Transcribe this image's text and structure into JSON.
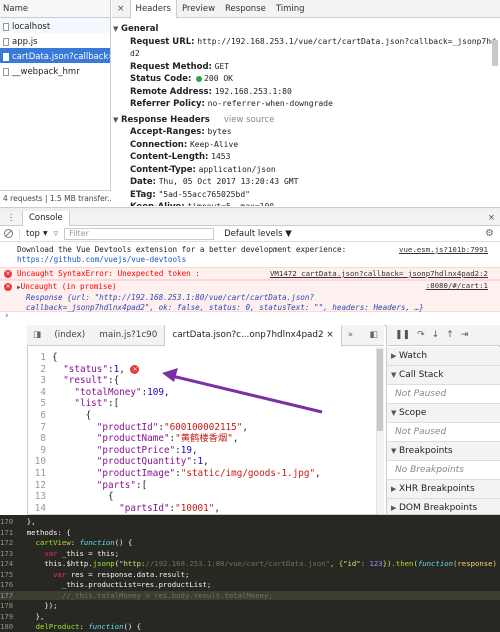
{
  "network": {
    "list_header": "Name",
    "requests": [
      "localhost",
      "app.js",
      "cartData.json?callback=_jsonp7hdlnx4pad2",
      "__webpack_hmr"
    ],
    "selected_index": 2,
    "status_bar": "4 requests | 1.5 MB transfer..."
  },
  "detail_tabs": {
    "close": "×",
    "tabs": [
      "Headers",
      "Preview",
      "Response",
      "Timing"
    ],
    "active": "Headers"
  },
  "general": {
    "title": "General",
    "request_url_key": "Request URL:",
    "request_url_val": "http://192.168.253.1/vue/cart/cartData.json?callback=_jsonp7hdlnx4pa",
    "request_url_val2": "d2",
    "method_key": "Request Method:",
    "method_val": "GET",
    "status_key": "Status Code:",
    "status_val": "200 OK",
    "remote_key": "Remote Address:",
    "remote_val": "192.168.253.1:80",
    "referrer_key": "Referrer Policy:",
    "referrer_val": "no-referrer-when-downgrade"
  },
  "response_headers": {
    "title": "Response Headers",
    "view_source": "view source",
    "items": [
      {
        "k": "Accept-Ranges:",
        "v": "bytes"
      },
      {
        "k": "Connection:",
        "v": "Keep-Alive"
      },
      {
        "k": "Content-Length:",
        "v": "1453"
      },
      {
        "k": "Content-Type:",
        "v": "application/json"
      },
      {
        "k": "Date:",
        "v": "Thu, 05 Oct 2017 13:20:43 GMT"
      },
      {
        "k": "ETag:",
        "v": "\"5ad-55acc765025bd\""
      },
      {
        "k": "Keep-Alive:",
        "v": "timeout=5, max=100"
      }
    ]
  },
  "console": {
    "menu": "⋮",
    "tab": "Console",
    "close": "×",
    "context": "top",
    "filter_placeholder": "Filter",
    "levels": "Default levels ▼",
    "lines": {
      "devtools_msg1": "Download the Vue Devtools extension for a better development experience:",
      "devtools_msg2": "https://github.com/vuejs/vue-devtools",
      "devtools_src": "vue.esm.js?101b:7991",
      "syntax_err": "Uncaught SyntaxError: Unexpected token :",
      "syntax_src": "VM1472 cartData.json?callback=_jsonp7hdlnx4pad2:2",
      "promise_err": "Uncaught (in promise)",
      "promise_src": ":8080/#/cart:1",
      "response_1": "Response {url: \"http://192.168.253.1:80/vue/cart/cartData.json?",
      "response_2": "callback=_jsonp7hdlnx4pad2\", ok: false, status: 0, statusText: \"\", headers: Headers, …}"
    },
    "prompt": "›"
  },
  "sources": {
    "tabs": [
      "(index)",
      "main.js?1c90",
      "cartData.json?c...onp7hdlnx4pad2"
    ],
    "active_tab": 2,
    "tab_close": "×",
    "nav_more": "»",
    "code": [
      {
        "n": "1",
        "t": "{"
      },
      {
        "n": "2",
        "t": "  \"status\":1,"
      },
      {
        "n": "3",
        "t": "  \"result\":{"
      },
      {
        "n": "4",
        "t": "    \"totalMoney\":109,"
      },
      {
        "n": "5",
        "t": "    \"list\":["
      },
      {
        "n": "6",
        "t": "      {"
      },
      {
        "n": "7",
        "t": "        \"productId\":\"600100002115\","
      },
      {
        "n": "8",
        "t": "        \"productName\":\"黄鹤楼香烟\","
      },
      {
        "n": "9",
        "t": "        \"productPrice\":19,"
      },
      {
        "n": "10",
        "t": "        \"productQuantity\":1,"
      },
      {
        "n": "11",
        "t": "        \"productImage\":\"static/img/goods-1.jpg\","
      },
      {
        "n": "12",
        "t": "        \"parts\":["
      },
      {
        "n": "13",
        "t": "          {"
      },
      {
        "n": "14",
        "t": "            \"partsId\":\"10001\","
      }
    ],
    "error_badge": "×"
  },
  "debugger": {
    "toolbar": [
      "❚❚",
      "↷",
      "↓",
      "↑",
      "⇥"
    ],
    "panes": [
      {
        "title": "Watch"
      },
      {
        "title": "Call Stack",
        "body": "Not Paused"
      },
      {
        "title": "Scope",
        "body": "Not Paused"
      },
      {
        "title": "Breakpoints",
        "body": "No Breakpoints"
      },
      {
        "title": "XHR Breakpoints"
      },
      {
        "title": "DOM Breakpoints"
      }
    ]
  },
  "editor": {
    "lines": [
      {
        "n": "170",
        "t": "  },"
      },
      {
        "n": "171",
        "t": "  methods: {"
      },
      {
        "n": "172",
        "t": "    cartView: function() {"
      },
      {
        "n": "173",
        "t": "      var _this = this;"
      },
      {
        "n": "174",
        "t": "      this.$http.jsonp(\"http://192.168.253.1:80/vue/cart/cartData.json\", {\"id\": 123}).then(function(response) {"
      },
      {
        "n": "175",
        "t": "        var res = response.data.result;"
      },
      {
        "n": "176",
        "t": "          _this.productList=res.productList;"
      },
      {
        "n": "177",
        "t": "          //_this.totalMoney = res.body.result.totalMoney;"
      },
      {
        "n": "178",
        "t": "      });"
      },
      {
        "n": "179",
        "t": "    },"
      },
      {
        "n": "180",
        "t": "    delProduct: function() {"
      }
    ]
  },
  "colors": {
    "accent": "#3879d9",
    "error": "#e53a3a",
    "arrow": "#7b2fa5",
    "editor_bg": "#272822"
  }
}
